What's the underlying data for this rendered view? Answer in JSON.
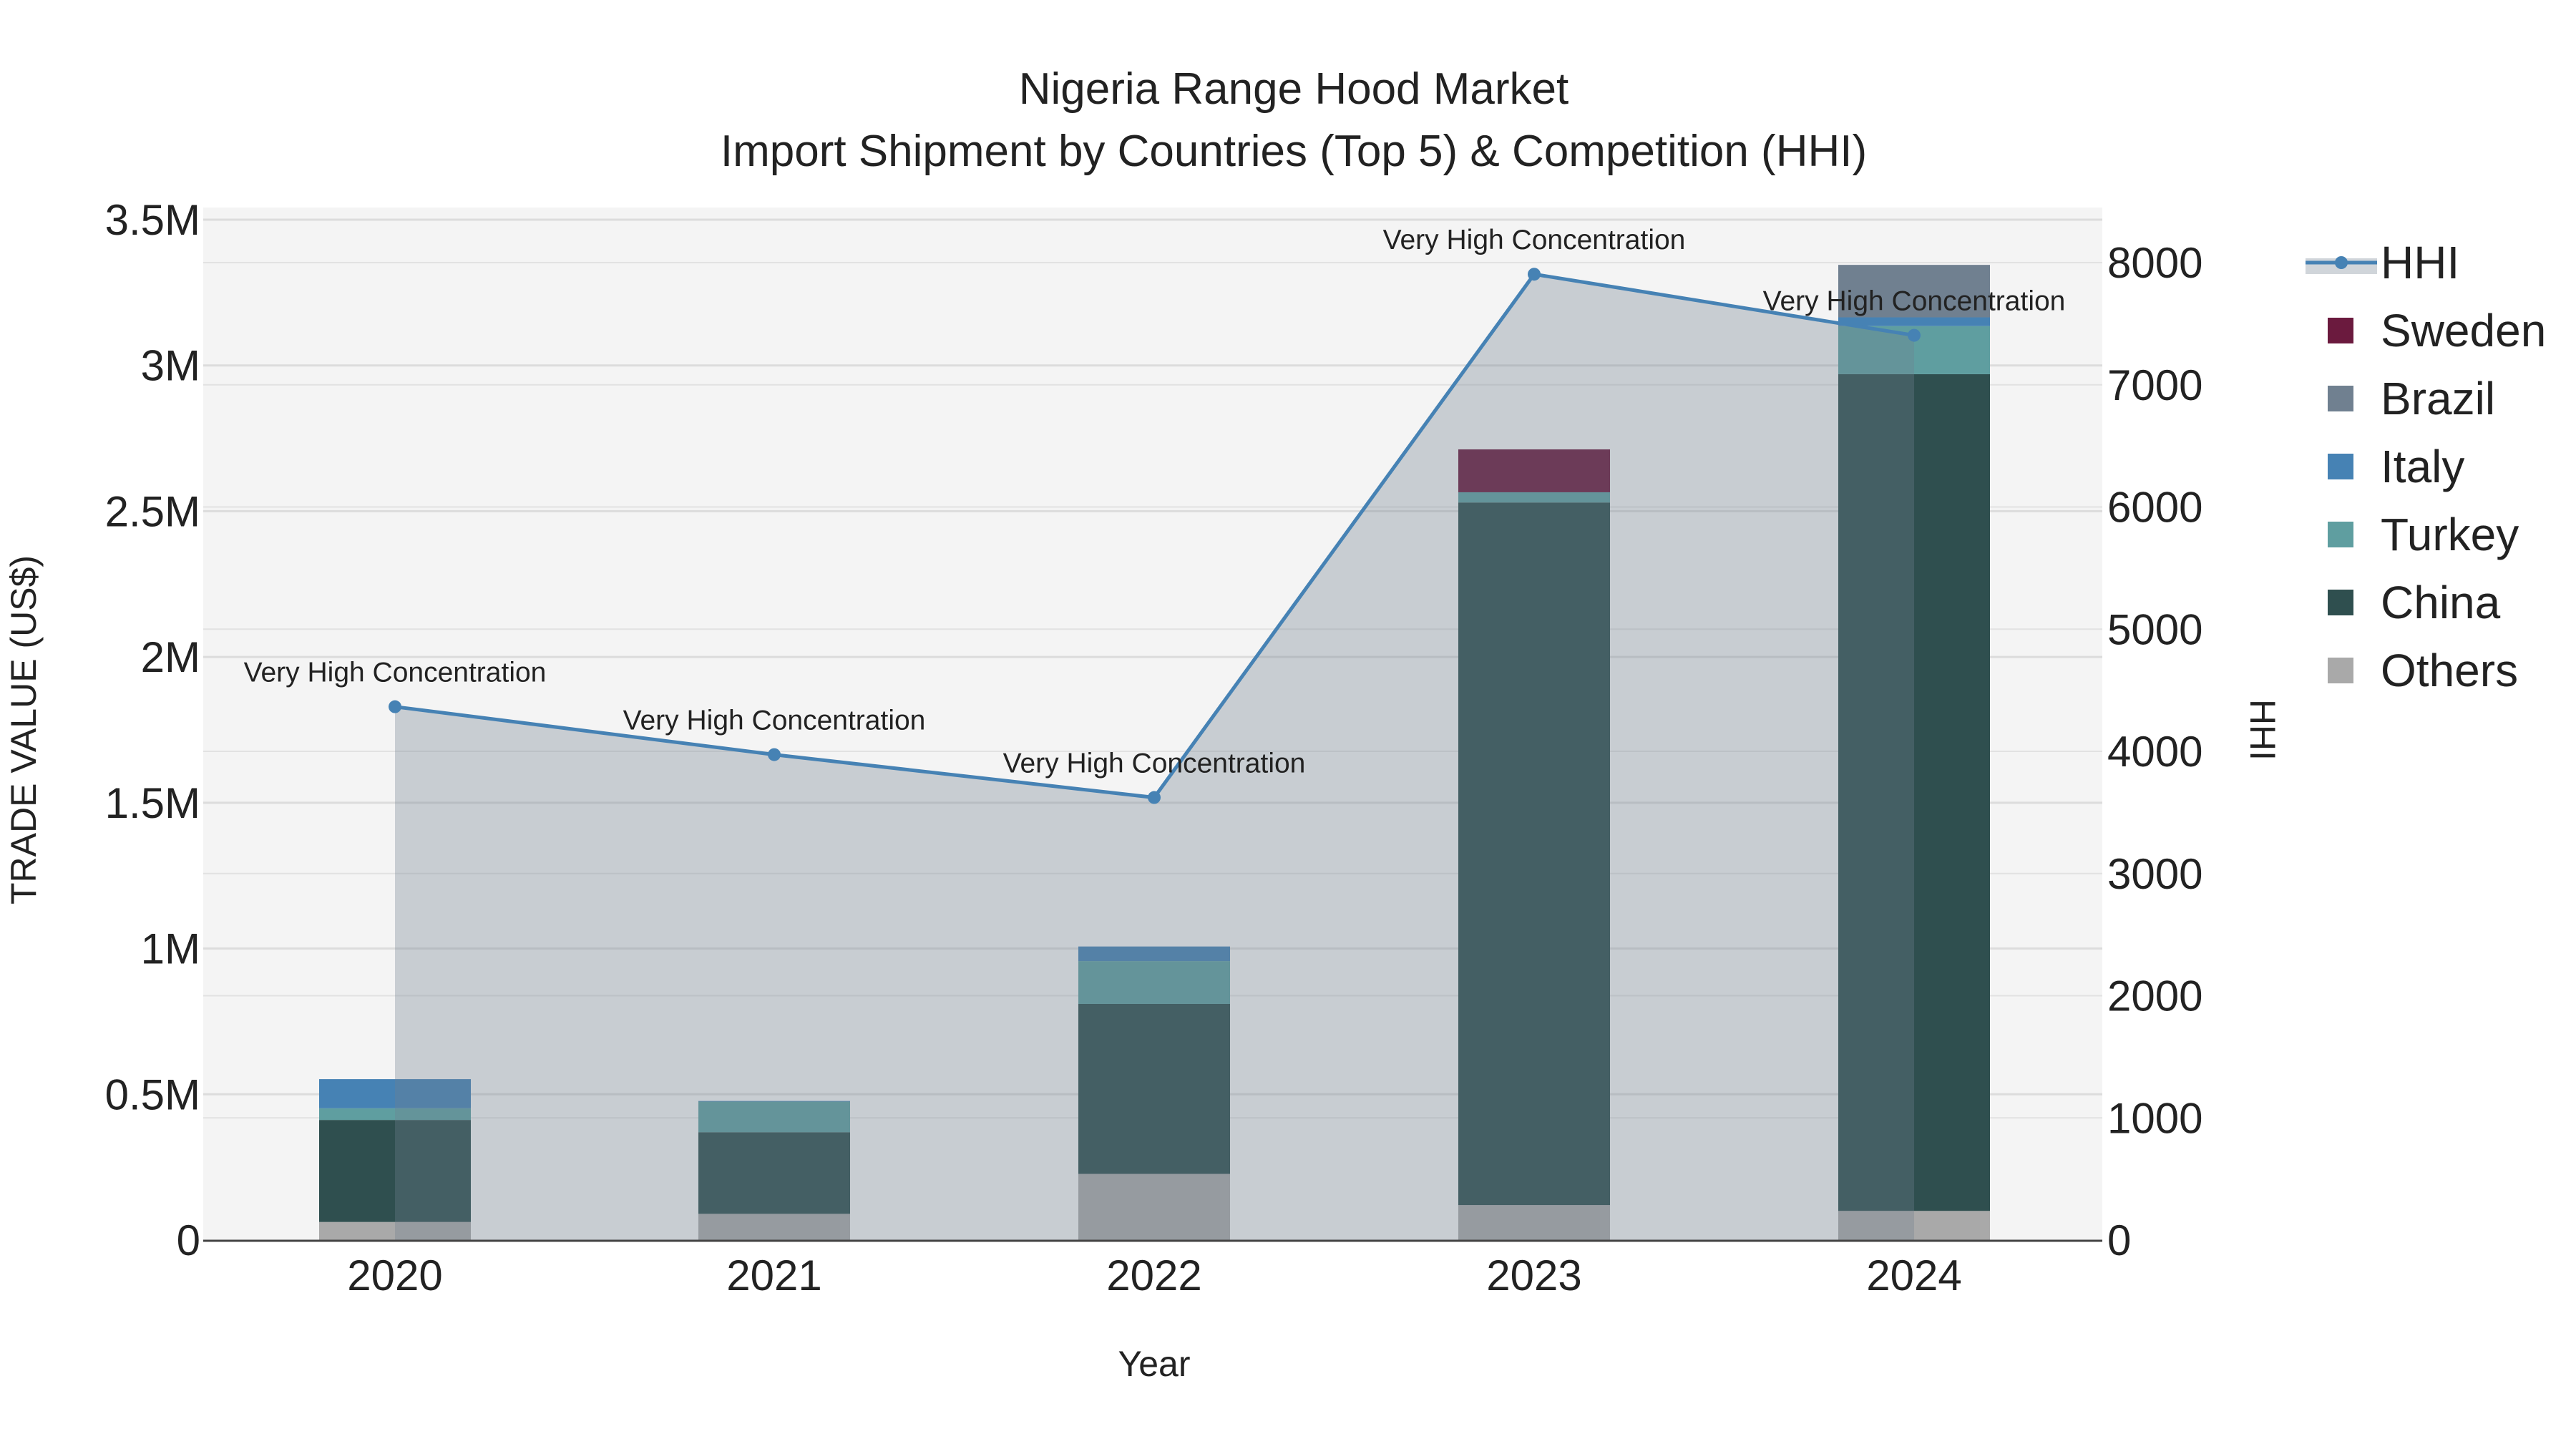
{
  "chart_data": {
    "type": "bar",
    "title": "Nigeria Range Hood Market",
    "subtitle": "Import Shipment by Countries (Top 5) & Competition (HHI)",
    "xlabel": "Year",
    "ylabel": "TRADE VALUE (US$)",
    "y2label": "HHI",
    "categories": [
      "2020",
      "2021",
      "2022",
      "2023",
      "2024"
    ],
    "ylim": [
      0,
      3500000
    ],
    "y2lim": [
      0,
      8350
    ],
    "yticks": [
      {
        "value": 0,
        "label": "0"
      },
      {
        "value": 500000,
        "label": "0.5M"
      },
      {
        "value": 1000000,
        "label": "1M"
      },
      {
        "value": 1500000,
        "label": "1.5M"
      },
      {
        "value": 2000000,
        "label": "2M"
      },
      {
        "value": 2500000,
        "label": "2.5M"
      },
      {
        "value": 3000000,
        "label": "3M"
      },
      {
        "value": 3500000,
        "label": "3.5M"
      }
    ],
    "y2ticks": [
      {
        "value": 0,
        "label": "0"
      },
      {
        "value": 1000,
        "label": "1000"
      },
      {
        "value": 2000,
        "label": "2000"
      },
      {
        "value": 3000,
        "label": "3000"
      },
      {
        "value": 4000,
        "label": "4000"
      },
      {
        "value": 5000,
        "label": "5000"
      },
      {
        "value": 6000,
        "label": "6000"
      },
      {
        "value": 7000,
        "label": "7000"
      },
      {
        "value": 8000,
        "label": "8000"
      }
    ],
    "series": [
      {
        "name": "Others",
        "color": "#a9a9a9",
        "values": [
          62000,
          90000,
          227000,
          120000,
          100000
        ]
      },
      {
        "name": "China",
        "color": "#2f4f4f",
        "values": [
          350000,
          280000,
          583000,
          2410000,
          2870000
        ]
      },
      {
        "name": "Turkey",
        "color": "#5f9ea0",
        "values": [
          40000,
          105000,
          147000,
          35000,
          165000
        ]
      },
      {
        "name": "Italy",
        "color": "#4682b4",
        "values": [
          100000,
          2000,
          50000,
          0,
          30000
        ]
      },
      {
        "name": "Brazil",
        "color": "#708090",
        "values": [
          0,
          0,
          0,
          0,
          180000
        ]
      },
      {
        "name": "Sweden",
        "color": "#6b1a3e",
        "values": [
          0,
          0,
          0,
          147000,
          0
        ]
      }
    ],
    "hhi": {
      "name": "HHI",
      "color": "#4682b4",
      "values": [
        4365,
        3973,
        3622,
        7905,
        7405
      ],
      "annotations": [
        "Very High Concentration",
        "Very High Concentration",
        "Very High Concentration",
        "Very High Concentration",
        "Very High Concentration"
      ]
    },
    "legend": {
      "placement": "right",
      "entries": [
        "HHI",
        "Sweden",
        "Brazil",
        "Italy",
        "Turkey",
        "China",
        "Others"
      ]
    },
    "grid": true
  }
}
